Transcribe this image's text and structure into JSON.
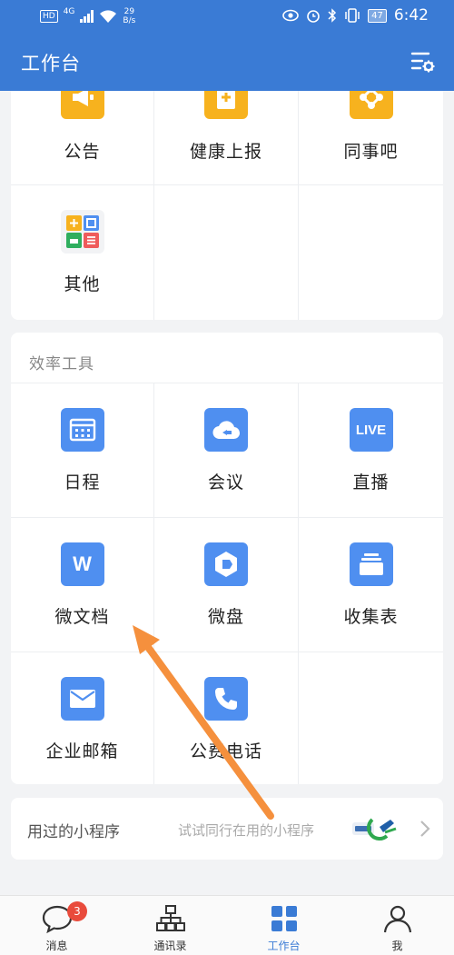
{
  "status_bar": {
    "hd": "HD",
    "net": "4G",
    "speed_value": "29",
    "speed_unit": "B/s",
    "battery": "47",
    "time": "6:42"
  },
  "header": {
    "title": "工作台",
    "settings_icon": "settings-sliders-icon"
  },
  "apps_top": [
    {
      "label": "公告",
      "icon": "megaphone-icon"
    },
    {
      "label": "健康上报",
      "icon": "health-report-icon"
    },
    {
      "label": "同事吧",
      "icon": "colleague-network-icon"
    },
    {
      "label": "其他",
      "icon": "other-apps-icon"
    }
  ],
  "efficiency": {
    "title": "效率工具",
    "items": [
      {
        "label": "日程",
        "icon": "calendar-icon"
      },
      {
        "label": "会议",
        "icon": "cloud-meeting-icon"
      },
      {
        "label": "直播",
        "icon": "live-icon",
        "icon_text": "LIVE"
      },
      {
        "label": "微文档",
        "icon": "document-w-icon",
        "icon_text": "W"
      },
      {
        "label": "微盘",
        "icon": "drive-icon"
      },
      {
        "label": "收集表",
        "icon": "collect-form-icon"
      },
      {
        "label": "企业邮箱",
        "icon": "mail-icon"
      },
      {
        "label": "公费电话",
        "icon": "phone-icon"
      }
    ]
  },
  "mini_programs": {
    "title": "用过的小程序",
    "hint": "试试同行在用的小程序"
  },
  "bottom_nav": [
    {
      "label": "消息",
      "icon": "message-bubble-icon",
      "badge": "3"
    },
    {
      "label": "通讯录",
      "icon": "org-chart-icon"
    },
    {
      "label": "工作台",
      "icon": "workbench-grid-icon",
      "active": true
    },
    {
      "label": "我",
      "icon": "person-icon"
    }
  ],
  "colors": {
    "primary": "#3a7bd5",
    "app_blue": "#4f8ff0",
    "app_orange": "#f7b21e",
    "badge_red": "#e94b3c",
    "arrow_orange": "#f5903d"
  }
}
